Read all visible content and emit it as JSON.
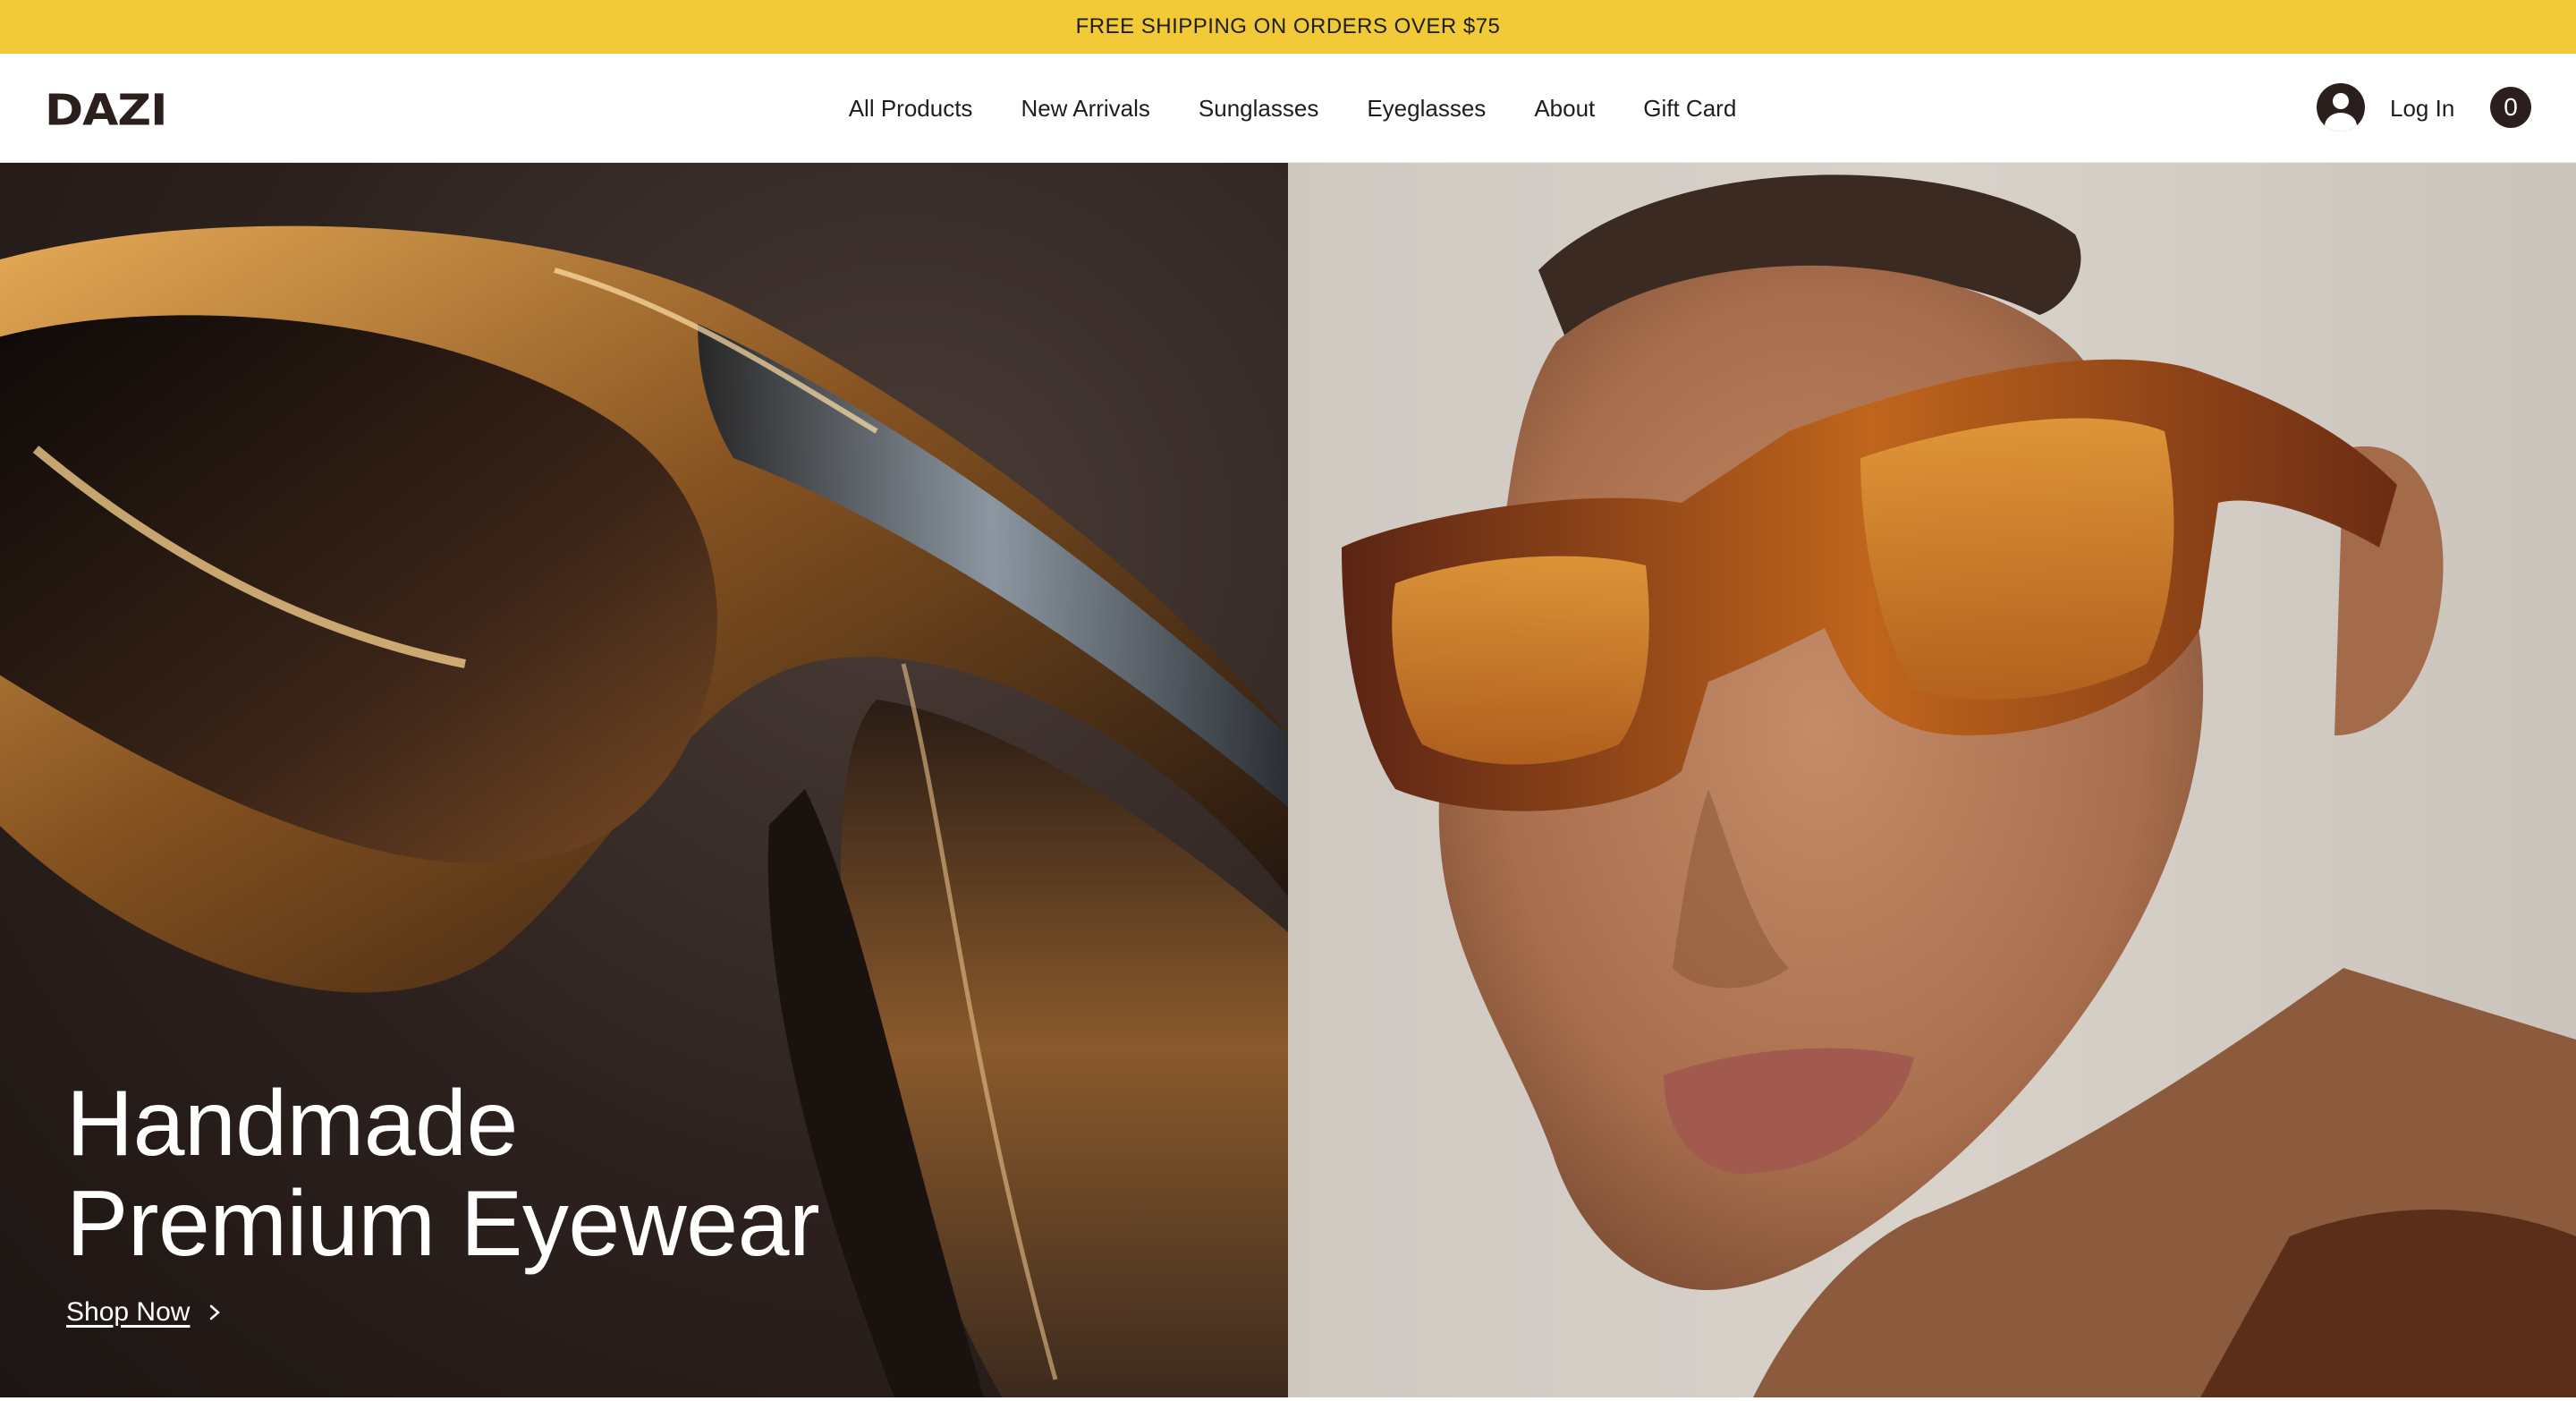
{
  "announcement": {
    "text": "FREE SHIPPING ON ORDERS OVER $75"
  },
  "header": {
    "logo": "DAZI",
    "nav": [
      "All Products",
      "New Arrivals",
      "Sunglasses",
      "Eyeglasses",
      "About",
      "Gift Card"
    ],
    "login_label": "Log In",
    "cart_count": "0",
    "account_icon": "account-icon"
  },
  "hero": {
    "heading_line1": "Handmade",
    "heading_line2": "Premium Eyewear",
    "cta_label": "Shop Now",
    "cta_icon": "chevron-right-icon",
    "left_image": "sunglasses-closeup-image",
    "right_image": "model-with-sunglasses-image"
  },
  "colors": {
    "announcement_bg": "#f2ca38",
    "brand_dark": "#2b1f1d",
    "hero_text": "#ffffff"
  }
}
